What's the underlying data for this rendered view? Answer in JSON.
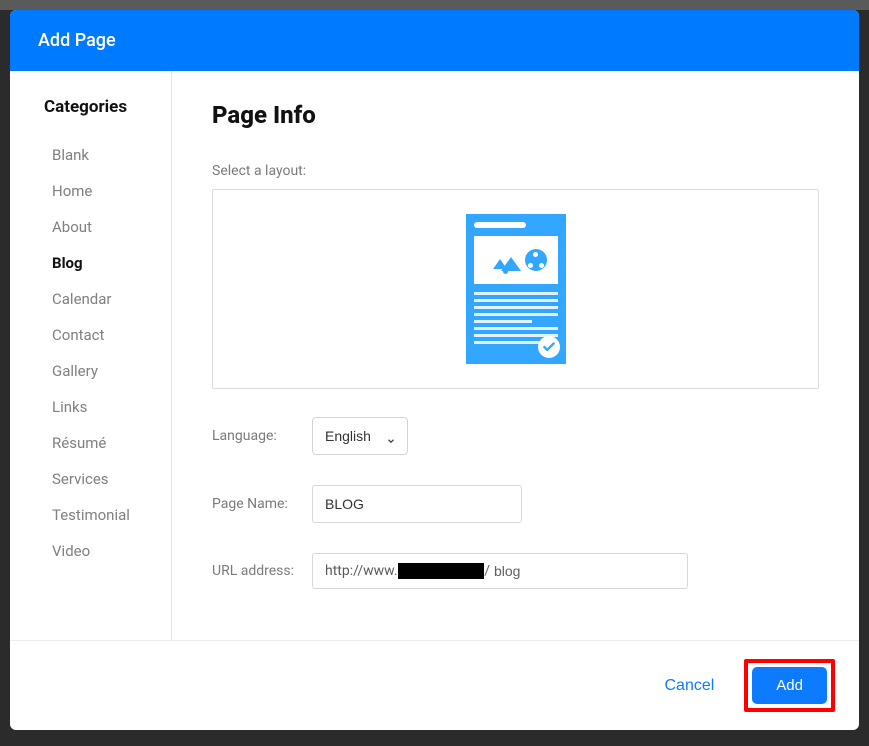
{
  "header": {
    "title": "Add Page"
  },
  "sidebar": {
    "heading": "Categories",
    "items": [
      {
        "label": "Blank",
        "active": false
      },
      {
        "label": "Home",
        "active": false
      },
      {
        "label": "About",
        "active": false
      },
      {
        "label": "Blog",
        "active": true
      },
      {
        "label": "Calendar",
        "active": false
      },
      {
        "label": "Contact",
        "active": false
      },
      {
        "label": "Gallery",
        "active": false
      },
      {
        "label": "Links",
        "active": false
      },
      {
        "label": "Résumé",
        "active": false
      },
      {
        "label": "Services",
        "active": false
      },
      {
        "label": "Testimonial",
        "active": false
      },
      {
        "label": "Video",
        "active": false
      }
    ]
  },
  "main": {
    "heading": "Page Info",
    "layout_label": "Select a layout:",
    "language_label": "Language:",
    "language_value": "English",
    "page_name_label": "Page Name:",
    "page_name_value": "BLOG",
    "url_label": "URL address:",
    "url_prefix": "http://www.",
    "url_separator": "/",
    "url_slug": "blog"
  },
  "footer": {
    "cancel": "Cancel",
    "add": "Add"
  }
}
